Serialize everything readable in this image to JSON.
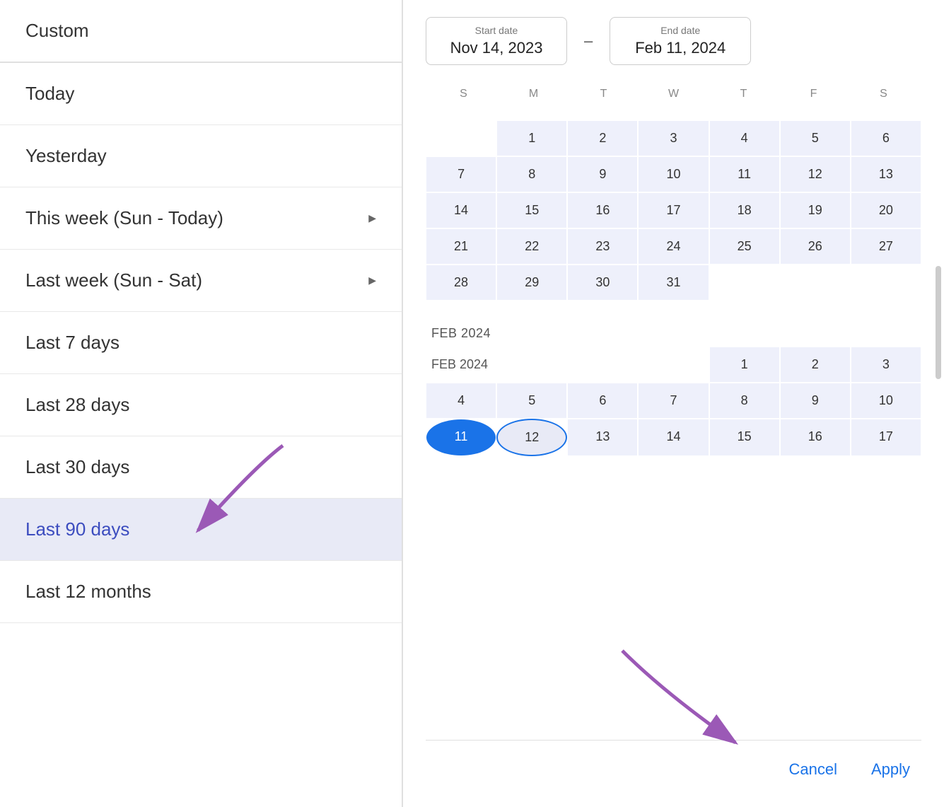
{
  "leftPanel": {
    "items": [
      {
        "id": "custom",
        "label": "Custom",
        "hasArrow": false,
        "selected": false,
        "dividerAfter": true
      },
      {
        "id": "today",
        "label": "Today",
        "hasArrow": false,
        "selected": false,
        "dividerAfter": false
      },
      {
        "id": "yesterday",
        "label": "Yesterday",
        "hasArrow": false,
        "selected": false,
        "dividerAfter": false
      },
      {
        "id": "this-week",
        "label": "This week (Sun - Today)",
        "hasArrow": true,
        "selected": false,
        "dividerAfter": false
      },
      {
        "id": "last-week",
        "label": "Last week (Sun - Sat)",
        "hasArrow": true,
        "selected": false,
        "dividerAfter": false
      },
      {
        "id": "last-7",
        "label": "Last 7 days",
        "hasArrow": false,
        "selected": false,
        "dividerAfter": false
      },
      {
        "id": "last-28",
        "label": "Last 28 days",
        "hasArrow": false,
        "selected": false,
        "dividerAfter": false
      },
      {
        "id": "last-30",
        "label": "Last 30 days",
        "hasArrow": false,
        "selected": false,
        "dividerAfter": false
      },
      {
        "id": "last-90",
        "label": "Last 90 days",
        "hasArrow": false,
        "selected": true,
        "dividerAfter": false
      },
      {
        "id": "last-12",
        "label": "Last 12 months",
        "hasArrow": false,
        "selected": false,
        "dividerAfter": false
      }
    ]
  },
  "dateRange": {
    "startLabel": "Start date",
    "startValue": "Nov 14, 2023",
    "separator": "–",
    "endLabel": "End date",
    "endValue": "Feb 11, 2024"
  },
  "calendar": {
    "dayLabels": [
      "S",
      "M",
      "T",
      "W",
      "T",
      "F",
      "S"
    ],
    "jan2024": {
      "monthLabel": "",
      "weeks": [
        [
          "",
          "1",
          "2",
          "3",
          "4",
          "5",
          "6"
        ],
        [
          "7",
          "8",
          "9",
          "10",
          "11",
          "12",
          "13"
        ],
        [
          "14",
          "15",
          "16",
          "17",
          "18",
          "19",
          "20"
        ],
        [
          "21",
          "22",
          "23",
          "24",
          "25",
          "26",
          "27"
        ],
        [
          "28",
          "29",
          "30",
          "31",
          "",
          "",
          ""
        ]
      ]
    },
    "feb2024": {
      "monthLabel": "FEB 2024",
      "weeks": [
        [
          "",
          "",
          "",
          "",
          "1",
          "2",
          "3"
        ],
        [
          "4",
          "5",
          "6",
          "7",
          "8",
          "9",
          "10"
        ],
        [
          "11",
          "12",
          "13",
          "14",
          "15",
          "16",
          "17"
        ]
      ]
    }
  },
  "actions": {
    "cancelLabel": "Cancel",
    "applyLabel": "Apply"
  },
  "annotations": {
    "arrow1": "points to Last 90 days",
    "arrow2": "points to Apply button"
  }
}
